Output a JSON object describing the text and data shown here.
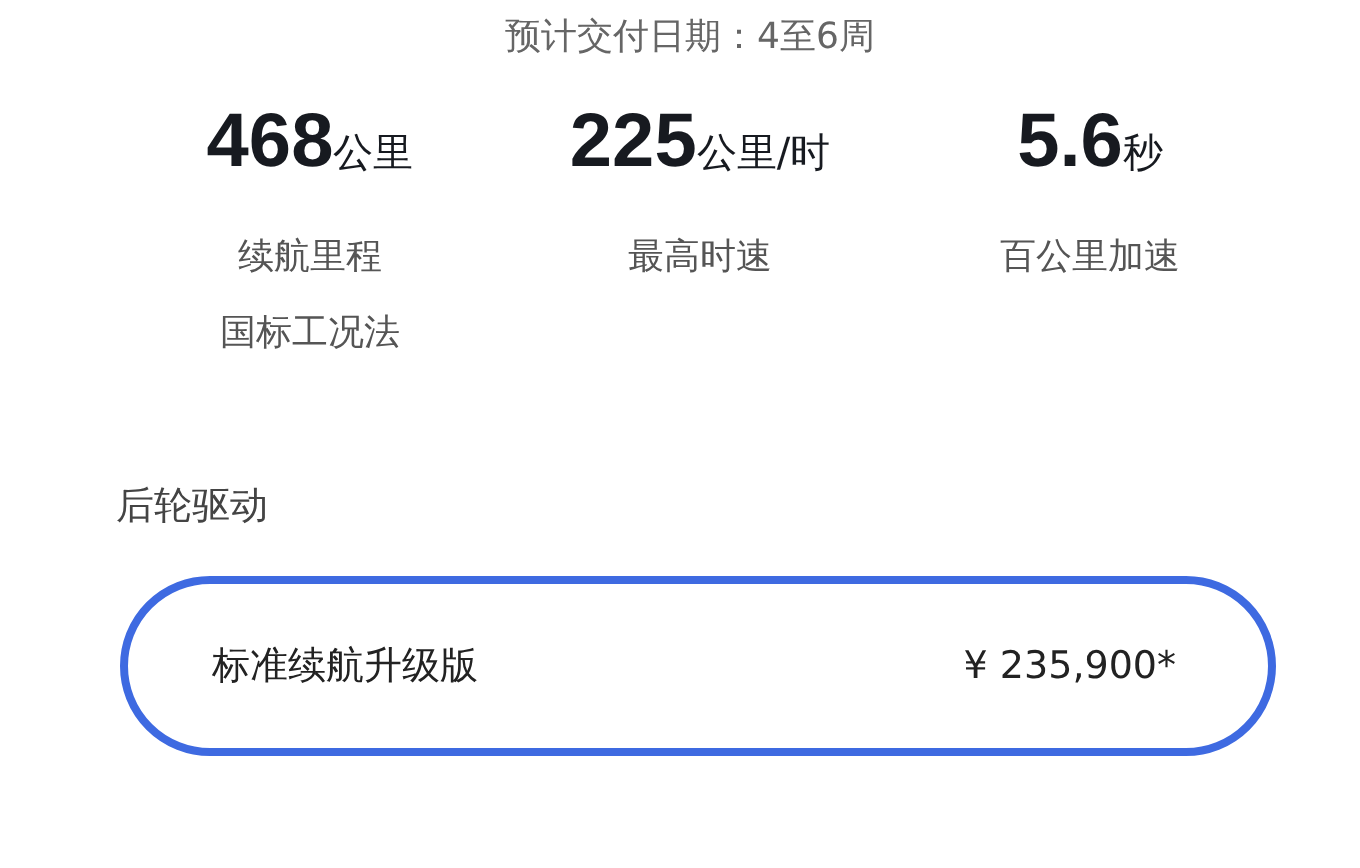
{
  "delivery": "预计交付日期：4至6周",
  "stats": [
    {
      "value": "468",
      "unit": "公里",
      "label": [
        "续航里程",
        "国标工况法"
      ]
    },
    {
      "value": "225",
      "unit": "公里/时",
      "label": [
        "最高时速"
      ]
    },
    {
      "value": "5.6",
      "unit": "秒",
      "label": [
        "百公里加速"
      ]
    }
  ],
  "section_title": "后轮驱动",
  "options": [
    {
      "name": "标准续航升级版",
      "price": "¥ 235,900*",
      "selected": true
    }
  ]
}
